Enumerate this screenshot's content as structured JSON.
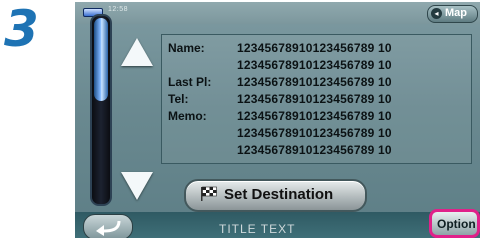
{
  "step_number": "3",
  "status_bar": {
    "time": "12:58",
    "map_button": "Map"
  },
  "details": [
    {
      "label": "Name:",
      "value": "12345678910123456789 10"
    },
    {
      "label": "",
      "value": "12345678910123456789 10"
    },
    {
      "label": "Last Pl:",
      "value": "12345678910123456789 10"
    },
    {
      "label": "Tel:",
      "value": "12345678910123456789 10"
    },
    {
      "label": "Memo:",
      "value": "12345678910123456789 10"
    },
    {
      "label": "",
      "value": "12345678910123456789 10"
    },
    {
      "label": "",
      "value": "12345678910123456789 10"
    }
  ],
  "set_destination_button": "Set Destination",
  "bottom": {
    "title": "TITLE TEXT",
    "option_button": "Option"
  },
  "colors": {
    "step": "#1e73b4",
    "option_highlight": "#e0218a"
  }
}
